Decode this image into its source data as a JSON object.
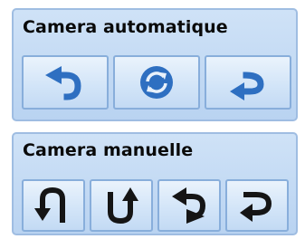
{
  "auto_panel": {
    "title": "Camera automatique",
    "buttons": [
      {
        "icon": "rotate-left-arrow-icon"
      },
      {
        "icon": "refresh-icon"
      },
      {
        "icon": "rotate-right-arrow-icon"
      }
    ]
  },
  "manual_panel": {
    "title": "Camera manuelle",
    "buttons": [
      {
        "icon": "u-turn-up-left-icon"
      },
      {
        "icon": "u-turn-up-right-icon"
      },
      {
        "icon": "u-turn-down-left-icon"
      },
      {
        "icon": "u-turn-left-icon"
      }
    ]
  },
  "colors": {
    "accent_blue": "#2e6fc1",
    "dark_arrow": "#151515",
    "panel_bg": "#c3daf4",
    "button_border": "#88aedb"
  }
}
